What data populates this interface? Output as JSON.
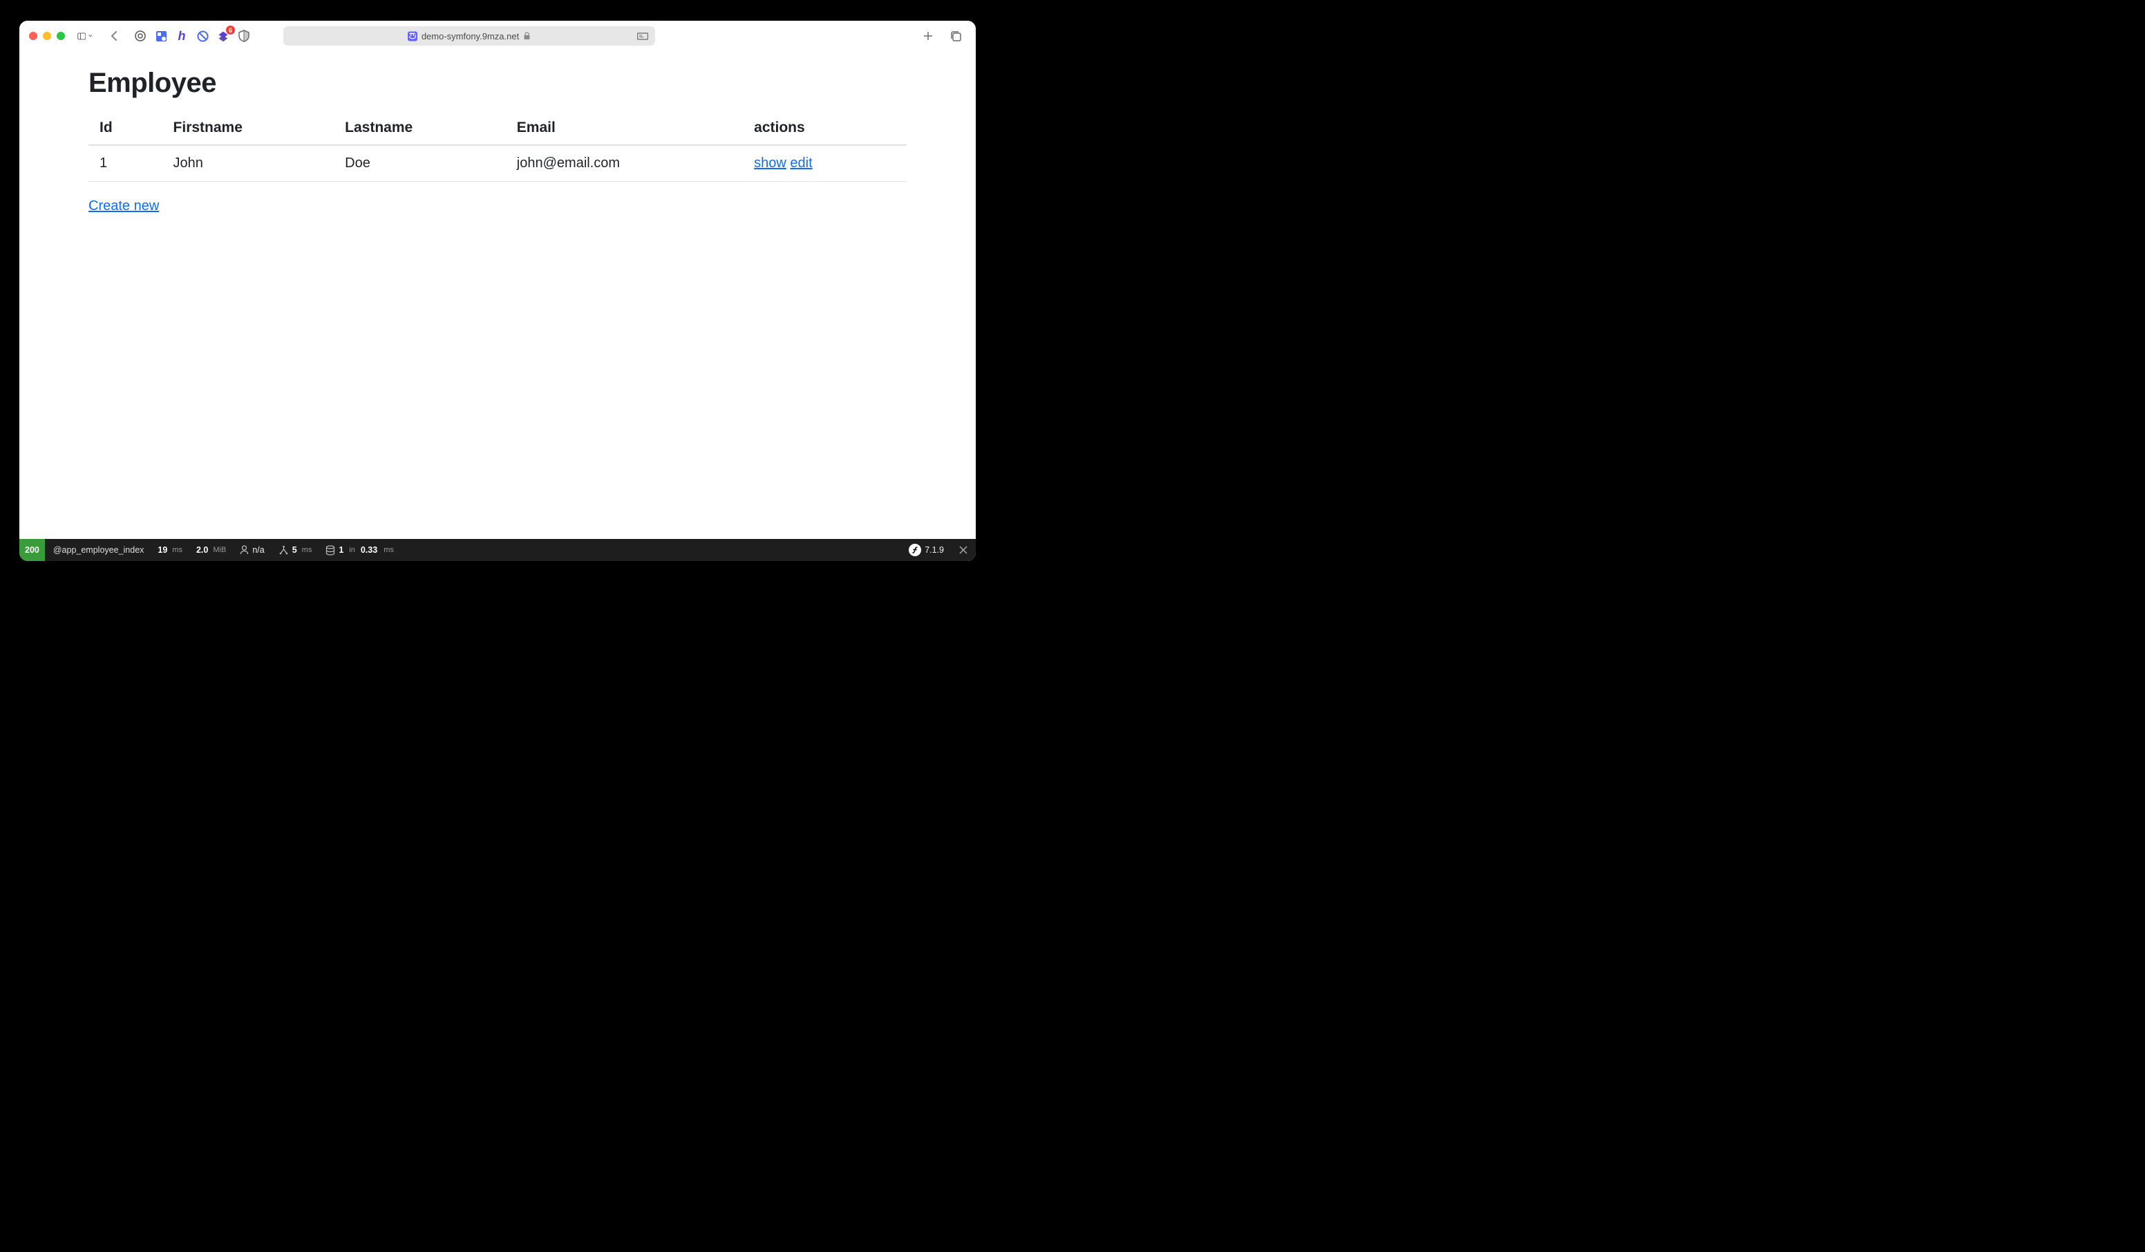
{
  "browser": {
    "url": "demo-symfony.9mza.net",
    "ext_badge": "6"
  },
  "page": {
    "title": "Employee",
    "create_label": "Create new",
    "table": {
      "headers": {
        "id": "Id",
        "firstname": "Firstname",
        "lastname": "Lastname",
        "email": "Email",
        "actions": "actions"
      },
      "rows": [
        {
          "id": "1",
          "firstname": "John",
          "lastname": "Doe",
          "email": "john@email.com",
          "show": "show",
          "edit": "edit"
        }
      ]
    }
  },
  "toolbar": {
    "status": "200",
    "route": "@app_employee_index",
    "time_val": "19",
    "time_unit": "ms",
    "mem_val": "2.0",
    "mem_unit": "MiB",
    "user": "n/a",
    "twig_val": "5",
    "twig_unit": "ms",
    "db_count": "1",
    "db_in": "in",
    "db_time": "0.33",
    "db_unit": "ms",
    "version": "7.1.9"
  }
}
